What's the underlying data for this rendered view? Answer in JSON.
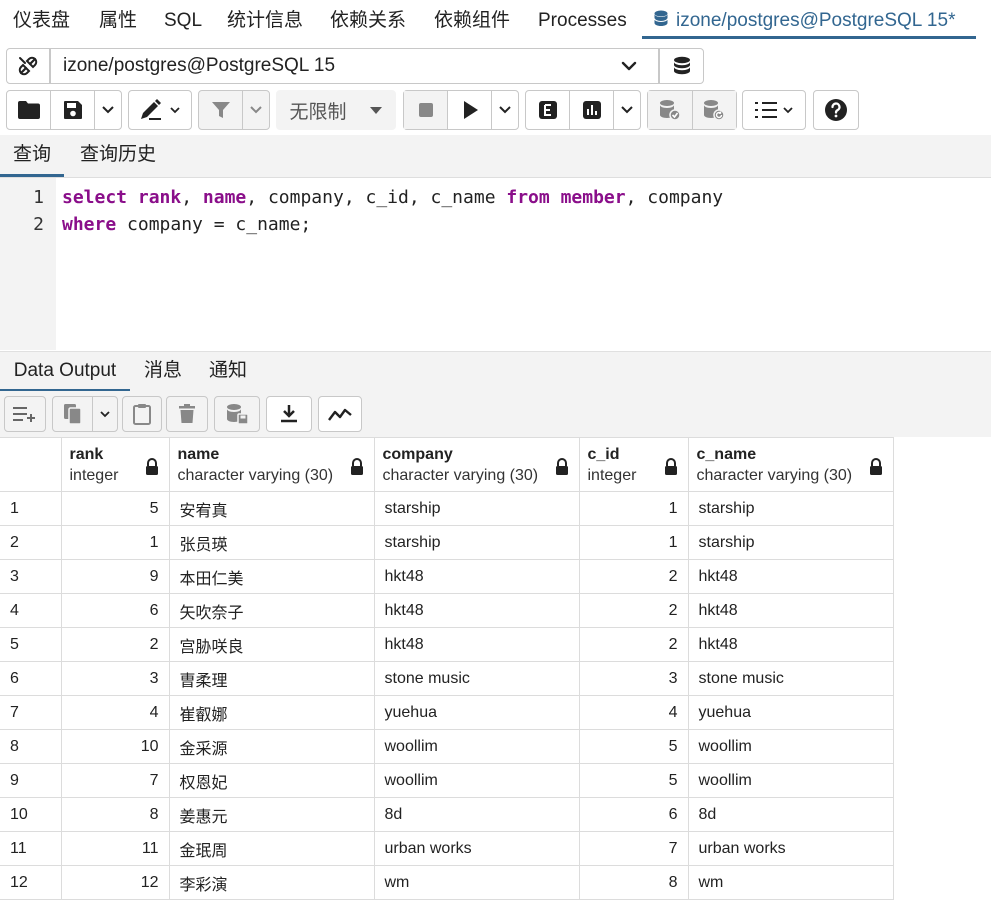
{
  "top_tabs": [
    "仪表盘",
    "属性",
    "SQL",
    "统计信息",
    "依赖关系",
    "依赖组件",
    "Processes"
  ],
  "active_tab": "izone/postgres@PostgreSQL 15*",
  "connection": {
    "label": "izone/postgres@PostgreSQL 15"
  },
  "toolbar": {
    "limit_label": "无限制"
  },
  "query_tabs": [
    "查询",
    "查询历史"
  ],
  "editor": {
    "line_numbers": [
      "1",
      "2"
    ],
    "line1": [
      {
        "t": "select",
        "kw": true
      },
      {
        "t": " "
      },
      {
        "t": "rank",
        "kw": true
      },
      {
        "t": ", "
      },
      {
        "t": "name",
        "kw": true
      },
      {
        "t": ", company, c_id, c_name "
      },
      {
        "t": "from",
        "kw": true
      },
      {
        "t": " "
      },
      {
        "t": "member",
        "kw": true
      },
      {
        "t": ", company"
      }
    ],
    "line2": [
      {
        "t": "where",
        "kw": true
      },
      {
        "t": " company = c_name;"
      }
    ]
  },
  "output_tabs": [
    "Data Output",
    "消息",
    "通知"
  ],
  "grid": {
    "columns": [
      {
        "name": "rank",
        "type": "integer"
      },
      {
        "name": "name",
        "type": "character varying (30)"
      },
      {
        "name": "company",
        "type": "character varying (30)"
      },
      {
        "name": "c_id",
        "type": "integer"
      },
      {
        "name": "c_name",
        "type": "character varying (30)"
      }
    ],
    "rows": [
      [
        "1",
        "5",
        "安宥真",
        "starship",
        "1",
        "starship"
      ],
      [
        "2",
        "1",
        "张员瑛",
        "starship",
        "1",
        "starship"
      ],
      [
        "3",
        "9",
        "本田仁美",
        "hkt48",
        "2",
        "hkt48"
      ],
      [
        "4",
        "6",
        "矢吹奈子",
        "hkt48",
        "2",
        "hkt48"
      ],
      [
        "5",
        "2",
        "宫胁咲良",
        "hkt48",
        "2",
        "hkt48"
      ],
      [
        "6",
        "3",
        "曺柔理",
        "stone music",
        "3",
        "stone music"
      ],
      [
        "7",
        "4",
        "崔叡娜",
        "yuehua",
        "4",
        "yuehua"
      ],
      [
        "8",
        "10",
        "金采源",
        "woollim",
        "5",
        "woollim"
      ],
      [
        "9",
        "7",
        "权恩妃",
        "woollim",
        "5",
        "woollim"
      ],
      [
        "10",
        "8",
        "姜惠元",
        "8d",
        "6",
        "8d"
      ],
      [
        "11",
        "11",
        "金珉周",
        "urban works",
        "7",
        "urban works"
      ],
      [
        "12",
        "12",
        "李彩演",
        "wm",
        "8",
        "wm"
      ]
    ]
  },
  "colors": {
    "accent": "#326690",
    "keyword": "#8a0e8a",
    "panel": "#f3f3f3"
  }
}
